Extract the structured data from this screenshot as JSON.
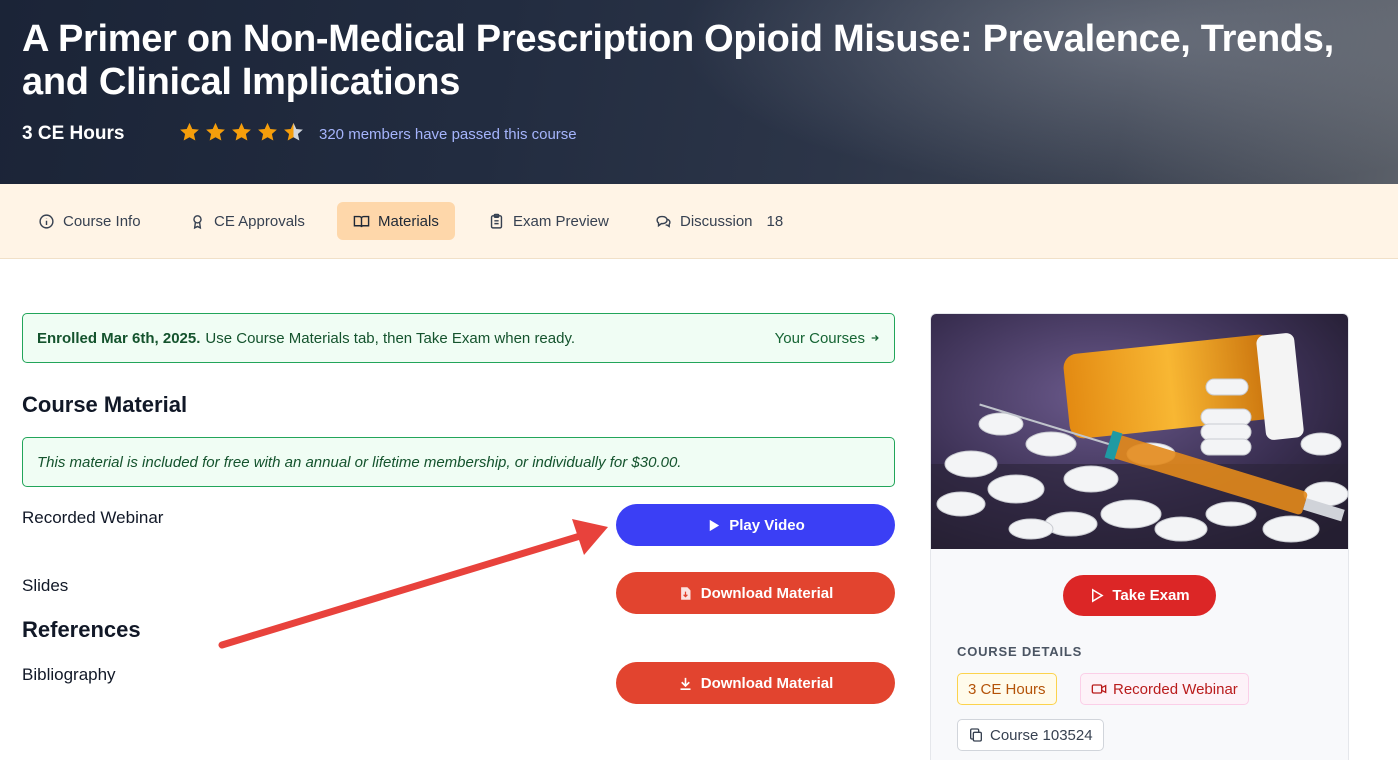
{
  "hero": {
    "title": "A Primer on Non-Medical Prescription Opioid Misuse: Prevalence, Trends, and Clinical Implications",
    "ce_hours": "3 CE Hours",
    "rating": 4.5,
    "members_text": "320 members have passed this course"
  },
  "tabs": [
    {
      "label": "Course Info",
      "icon": "info-icon"
    },
    {
      "label": "CE Approvals",
      "icon": "award-icon"
    },
    {
      "label": "Materials",
      "icon": "book-icon",
      "active": true
    },
    {
      "label": "Exam Preview",
      "icon": "clipboard-icon"
    },
    {
      "label": "Discussion",
      "icon": "chat-icon",
      "count": "18"
    }
  ],
  "enrolled": {
    "bold": "Enrolled Mar 6th, 2025.",
    "text": "Use Course Materials tab, then Take Exam when ready.",
    "link": "Your Courses"
  },
  "material": {
    "heading": "Course Material",
    "note": "This material is included for free with an annual or lifetime membership, or individually for $30.00.",
    "rows": [
      {
        "label": "Recorded Webinar",
        "button": "Play Video"
      },
      {
        "label": "Slides",
        "button": "Download Material"
      }
    ]
  },
  "references": {
    "heading": "References",
    "rows": [
      {
        "label": "Bibliography",
        "button": "Download Material"
      }
    ]
  },
  "card": {
    "take_exam": "Take Exam",
    "details_label": "COURSE DETAILS",
    "chip_hours": "3 CE Hours",
    "chip_format": "Recorded Webinar",
    "chip_course": "Course 103524"
  },
  "colors": {
    "accent_blue": "#3b3ff5",
    "download_red": "#e2442f",
    "exam_red": "#dc2626",
    "star_orange": "#f59e0b",
    "success_green": "#22a55a"
  }
}
